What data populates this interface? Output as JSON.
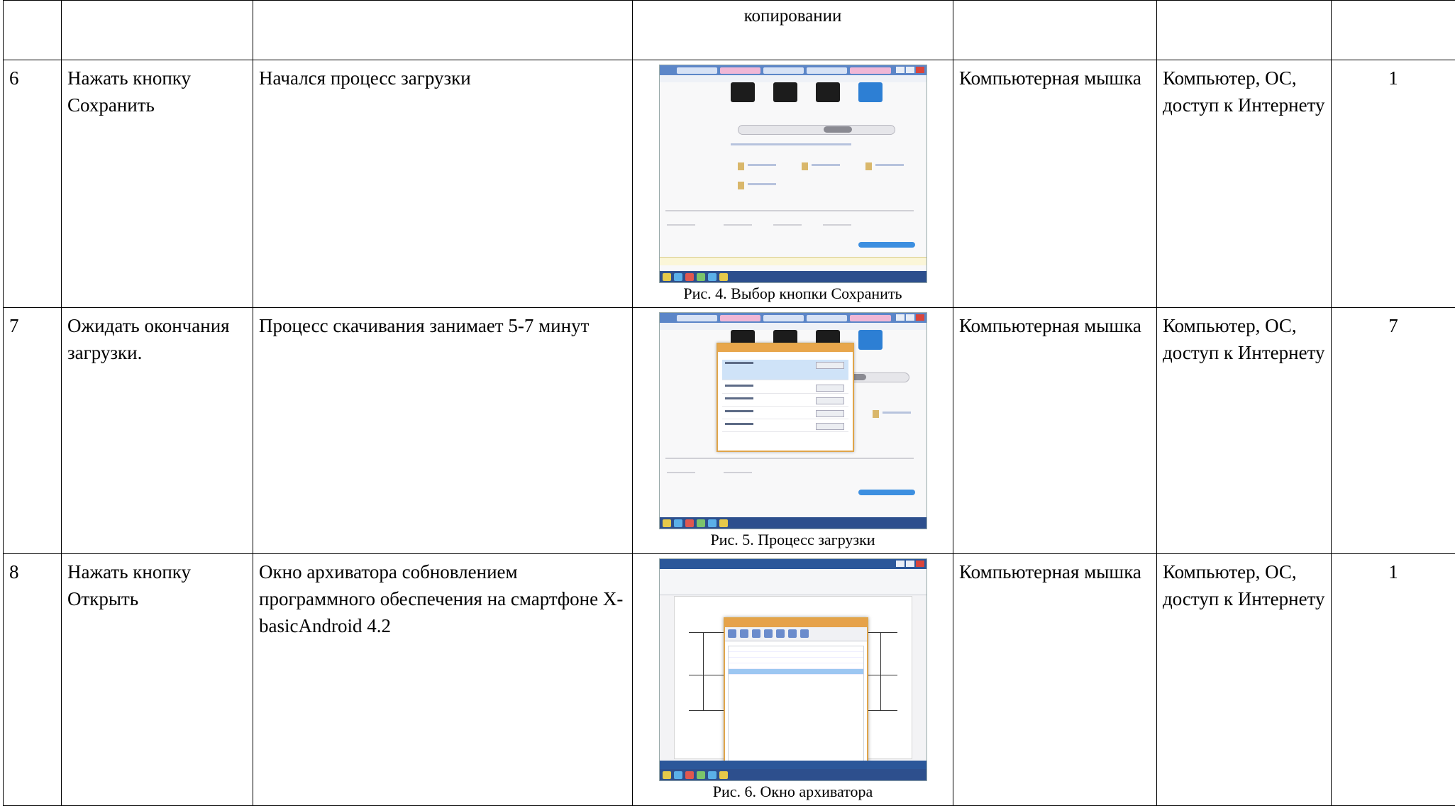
{
  "rows": [
    {
      "num": "",
      "action": "",
      "result": "",
      "figure_top_text": "копировании",
      "tool": "",
      "resources": "",
      "qty": ""
    },
    {
      "num": "6",
      "action": "Нажать кнопку Сохранить",
      "result": "Начался процесс загрузки",
      "caption": "Рис. 4. Выбор кнопки Сохранить",
      "tool": "Компьютерная мышка",
      "resources": "Компьютер, ОС, доступ к Интернету",
      "qty": "1"
    },
    {
      "num": "7",
      "action": "Ожидать окончания загрузки.",
      "result": "Процесс скачивания занимает 5-7 минут",
      "caption": "Рис. 5. Процесс загрузки",
      "tool": "Компьютерная мышка",
      "resources": "Компьютер, ОС, доступ к Интернету",
      "qty": "7"
    },
    {
      "num": "8",
      "action": "Нажать кнопку Открыть",
      "result": "Окно архиватора собновлением программного обеспечения на смартфоне X-basicAndroid 4.2",
      "caption": "Рис. 6. Окно архиватора",
      "tool": "Компьютерная мышка",
      "resources": "Компьютер, ОС, доступ к Интернету",
      "qty": "1"
    }
  ]
}
